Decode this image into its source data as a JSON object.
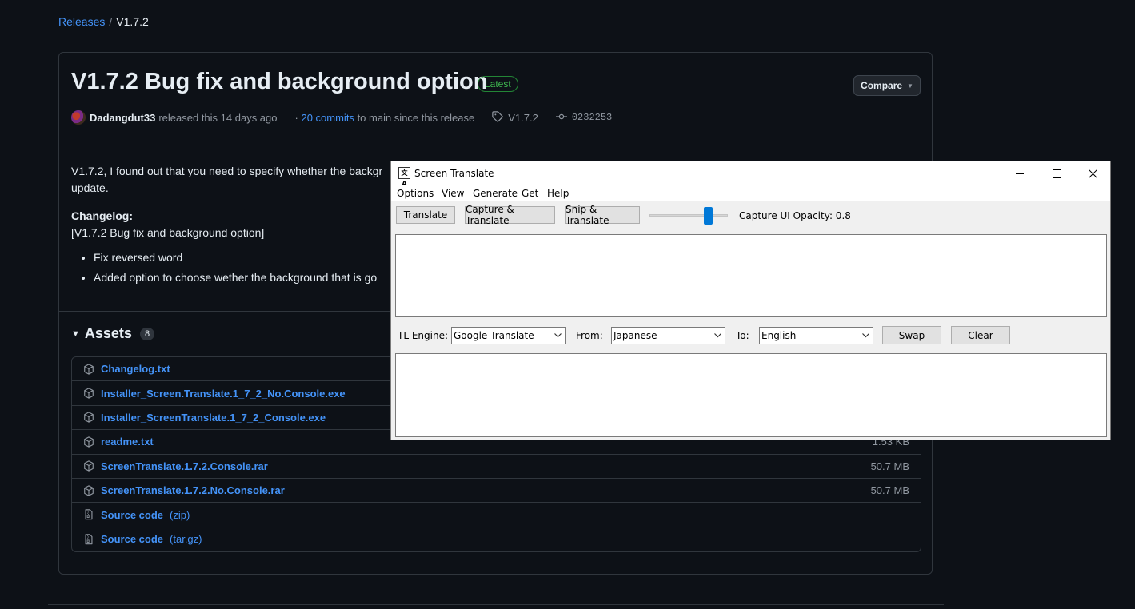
{
  "breadcrumb": {
    "releases": "Releases",
    "separator": "/",
    "current": "V1.7.2"
  },
  "release": {
    "title": "V1.7.2 Bug fix and background option",
    "badge": "Latest",
    "compare_label": "Compare",
    "author": "Dadangdut33",
    "released_text": "released this 14 days ago",
    "commits_prefix": "·",
    "commits_link": "20 commits",
    "commits_suffix": "to main since this release",
    "tag": "V1.7.2",
    "commit_hash": "0232253",
    "body_line1": "V1.7.2, I found out that you need to specify whether the backgr",
    "body_line2": "update.",
    "changelog_label": "Changelog:",
    "changelog_title": "[V1.7.2 Bug fix and background option]",
    "bullets": [
      "Fix reversed word",
      "Added option to choose wether the background that is go"
    ]
  },
  "assets": {
    "label": "Assets",
    "count": "8",
    "items": [
      {
        "name": "Changelog.txt",
        "ext": "",
        "size": "",
        "icon": "package-icon"
      },
      {
        "name": "Installer_Screen.Translate.1_7_2_No.Console.exe",
        "ext": "",
        "size": "",
        "icon": "package-icon"
      },
      {
        "name": "Installer_ScreenTranslate.1_7_2_Console.exe",
        "ext": "",
        "size": "",
        "icon": "package-icon"
      },
      {
        "name": "readme.txt",
        "ext": "",
        "size": "1.53 KB",
        "icon": "package-icon"
      },
      {
        "name": "ScreenTranslate.1.7.2.Console.rar",
        "ext": "",
        "size": "50.7 MB",
        "icon": "package-icon"
      },
      {
        "name": "ScreenTranslate.1.7.2.No.Console.rar",
        "ext": "",
        "size": "50.7 MB",
        "icon": "package-icon"
      },
      {
        "name": "Source code",
        "ext": "(zip)",
        "size": "",
        "icon": "file-zip-icon"
      },
      {
        "name": "Source code",
        "ext": "(tar.gz)",
        "size": "",
        "icon": "file-zip-icon"
      }
    ]
  },
  "app": {
    "title": "Screen Translate",
    "menu": [
      "Options",
      "View",
      "Generate",
      "Get",
      "Help"
    ],
    "buttons": {
      "translate": "Translate",
      "capture": "Capture & Translate",
      "snip": "Snip & Translate",
      "swap": "Swap",
      "clear": "Clear"
    },
    "opacity_label": "Capture UI Opacity: 0.8",
    "opacity_value": 0.8,
    "tl_engine_label": "TL Engine:",
    "tl_engine_value": "Google Translate",
    "from_label": "From:",
    "from_value": "Japanese",
    "to_label": "To:",
    "to_value": "English",
    "source_text": "",
    "result_text": ""
  }
}
